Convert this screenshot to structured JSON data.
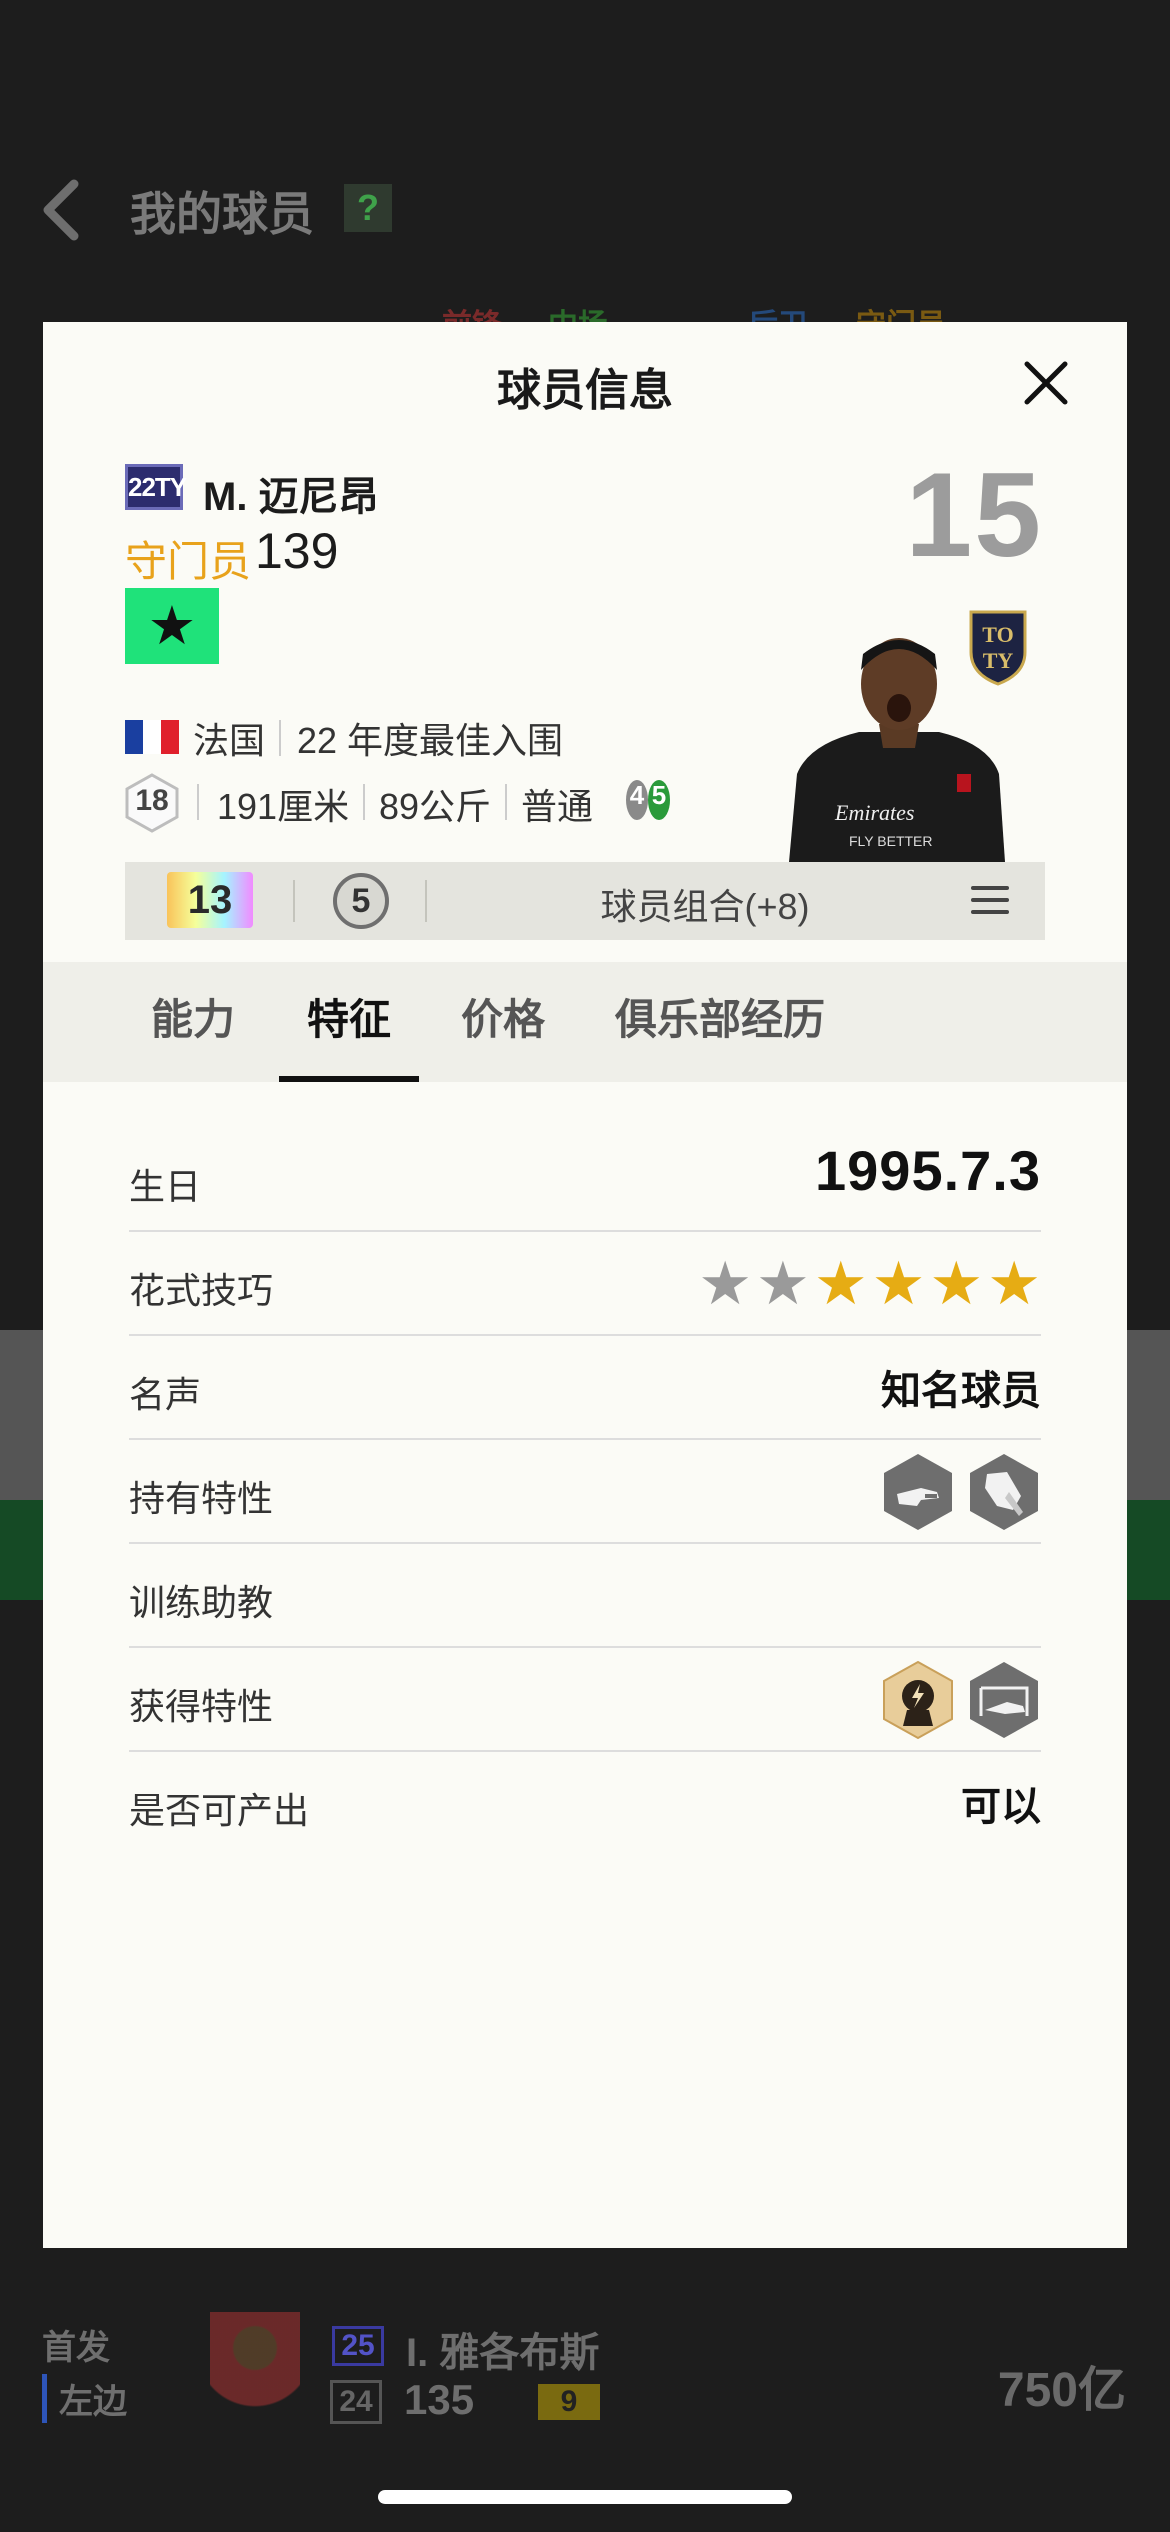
{
  "background": {
    "title": "我的球员",
    "help": "?",
    "filters": [
      {
        "label": "前锋",
        "color": "#7a2a2a"
      },
      {
        "label": "中场",
        "color": "#2a6a2a"
      },
      {
        "label": "后卫",
        "color": "#24497a"
      },
      {
        "label": "守门员",
        "color": "#7a5a12"
      }
    ],
    "row": {
      "role": "首发",
      "side": "左边",
      "season": "25",
      "name": "I. 雅各布斯",
      "level": "24",
      "overall": "135",
      "tag": "9",
      "price": "750亿"
    }
  },
  "modal": {
    "title": "球员信息",
    "close_icon": "close-icon",
    "player": {
      "season": "22TY",
      "name": "M. 迈尼昂",
      "position": "守门员",
      "overall": "139",
      "number": "15",
      "favorite_icon": "★",
      "nation": "法国",
      "award": "22 年度最佳入围",
      "level": "18",
      "height": "191厘米",
      "weight": "89公斤",
      "body_type": "普通",
      "foot_left": "4",
      "foot_right": "5"
    },
    "combo": {
      "team_color": "13",
      "chemistry": "5",
      "label": "球员组合(+8)"
    },
    "tabs": [
      {
        "label": "能力",
        "active": false
      },
      {
        "label": "特征",
        "active": true
      },
      {
        "label": "价格",
        "active": false
      },
      {
        "label": "俱乐部经历",
        "active": false
      }
    ],
    "details": {
      "birthday_label": "生日",
      "birthday_value": "1995.7.3",
      "skill_label": "花式技巧",
      "skill_stars": 4,
      "skill_stars_max": 6,
      "fame_label": "名声",
      "fame_value": "知名球员",
      "traits_label": "持有特性",
      "trainer_label": "训练助教",
      "acquired_label": "获得特性",
      "tradable_label": "是否可产出",
      "tradable_value": "可以"
    },
    "colors": {
      "position": "#e8a21b",
      "favorite": "#1fe27a",
      "star_gold": "#e6ac14",
      "star_grey": "#9a9a9a"
    }
  }
}
